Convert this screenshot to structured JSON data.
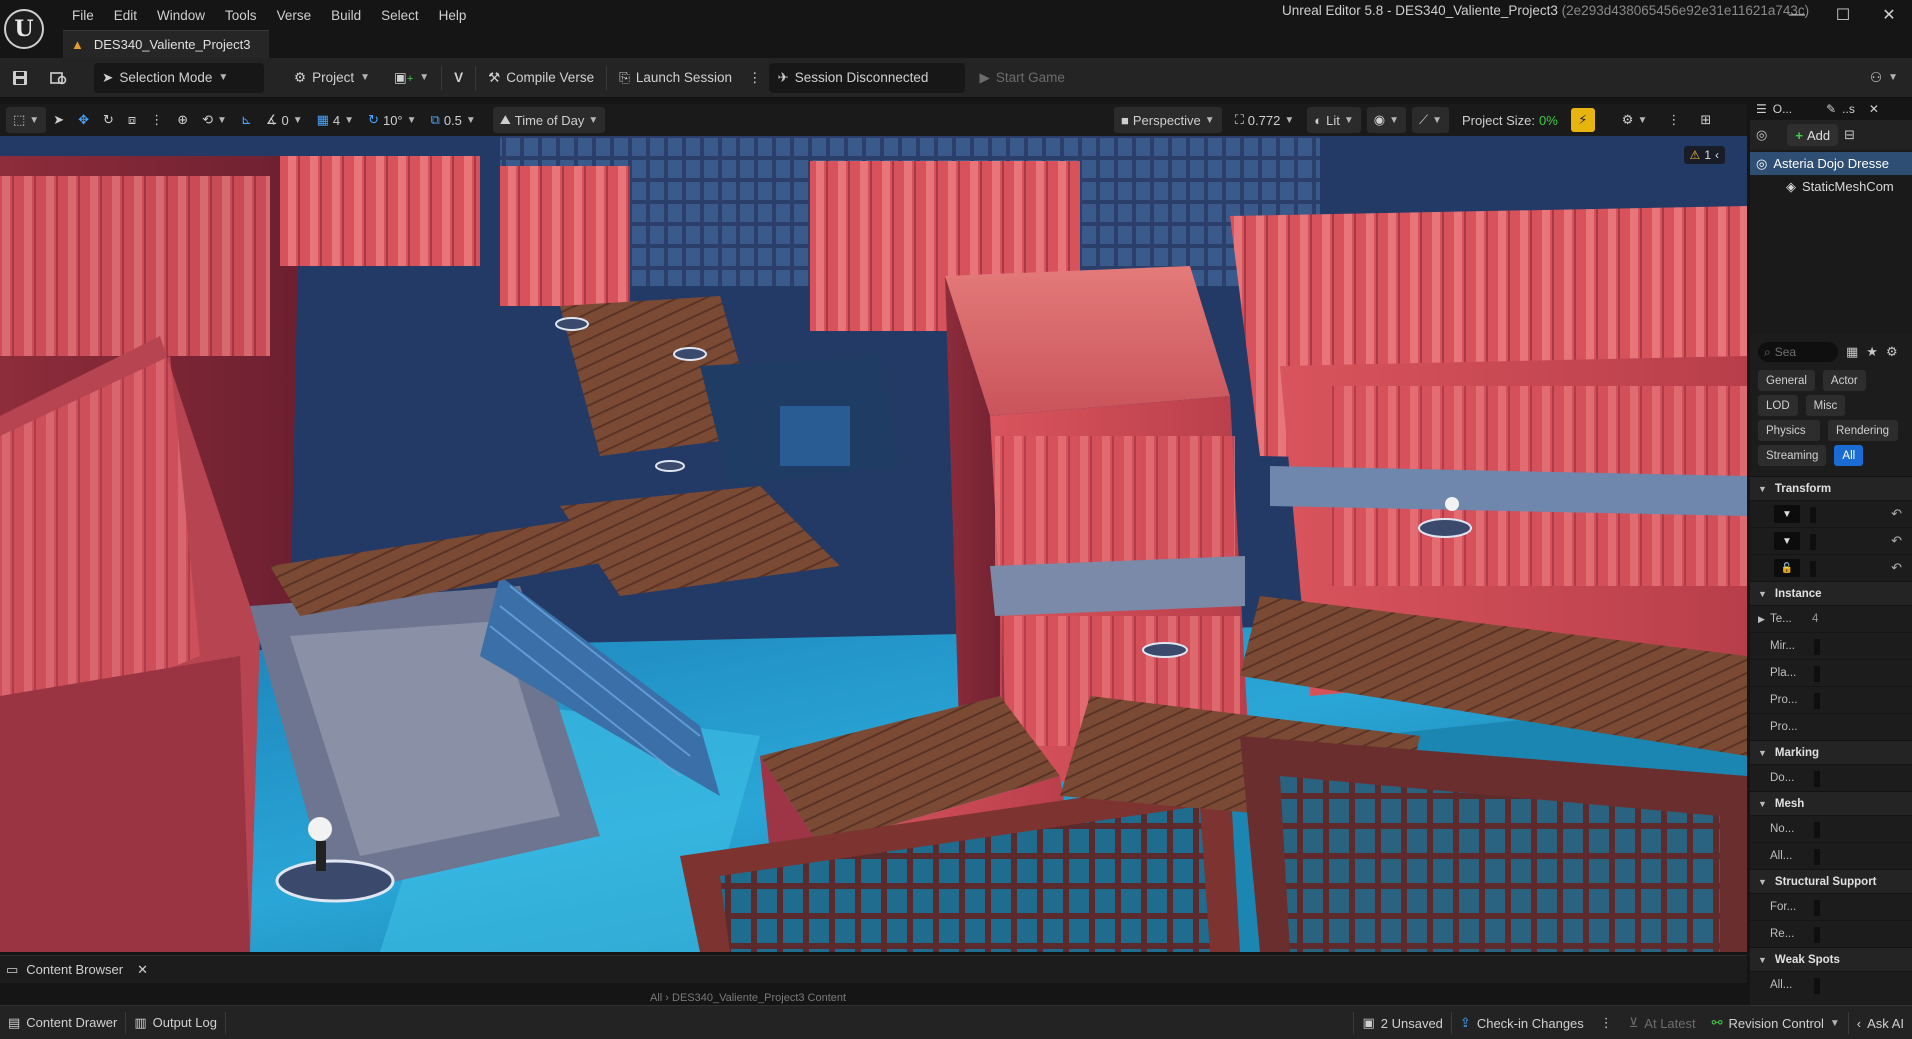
{
  "menu": [
    "File",
    "Edit",
    "Window",
    "Tools",
    "Verse",
    "Build",
    "Select",
    "Help"
  ],
  "window": {
    "title": "Unreal Editor 5.8 - DES340_Valiente_Project3",
    "hash": "(2e293d438065456e92e31e11621a743c)",
    "project_tab": "DES340_Valiente_Project3"
  },
  "toolbar": {
    "selection_mode": "Selection Mode",
    "project": "Project",
    "compile_verse": "Compile Verse",
    "launch_session": "Launch Session",
    "session_status": "Session Disconnected",
    "start_game": "Start Game"
  },
  "viewport_toolbar": {
    "rotation_snap": "0",
    "grid_size": "4",
    "angle": "10°",
    "scale_snap": "0.5",
    "time_of_day": "Time of Day",
    "perspective": "Perspective",
    "camera_speed": "0.772",
    "lit": "Lit",
    "project_size_label": "Project Size:",
    "project_size_value": "0%"
  },
  "viewport": {
    "warning_count": "1"
  },
  "outliner": {
    "tab1": "O...",
    "tab2": "..s",
    "add_label": "Add",
    "selected_item": "Asteria Dojo Dresse",
    "child_item": "StaticMeshCom"
  },
  "details": {
    "search_placeholder": "Sea",
    "categories": [
      "General",
      "Actor",
      "LOD",
      "Misc",
      "Physics",
      "Rendering",
      "Streaming",
      "All"
    ],
    "active_category": "All",
    "sections": [
      {
        "name": "Transform",
        "props": [
          "",
          "",
          ""
        ]
      },
      {
        "name": "Instance",
        "props": [
          "Te...",
          "Mir...",
          "Pla...",
          "Pro...",
          "Pro..."
        ]
      },
      {
        "name": "Marking",
        "props": [
          "Do..."
        ]
      },
      {
        "name": "Mesh",
        "props": [
          "No...",
          "All..."
        ]
      },
      {
        "name": "Structural Support",
        "props": [
          "For...",
          "Re..."
        ]
      },
      {
        "name": "Weak Spots",
        "props": [
          "All..."
        ]
      }
    ]
  },
  "content_browser": {
    "title": "Content Browser",
    "ghost_path": "All  ›  DES340_Valiente_Project3 Content"
  },
  "statusbar": {
    "content_drawer": "Content Drawer",
    "output_log": "Output Log",
    "unsaved": "2 Unsaved",
    "checkin": "Check-in Changes",
    "at_latest": "At Latest",
    "revision_control": "Revision Control",
    "ask_ai": "Ask AI"
  },
  "colors": {
    "accent_blue": "#1a6bd4",
    "selection_blue": "#2e4e74",
    "warning_yellow": "#e8b510",
    "project_size_green": "#35d23b"
  }
}
